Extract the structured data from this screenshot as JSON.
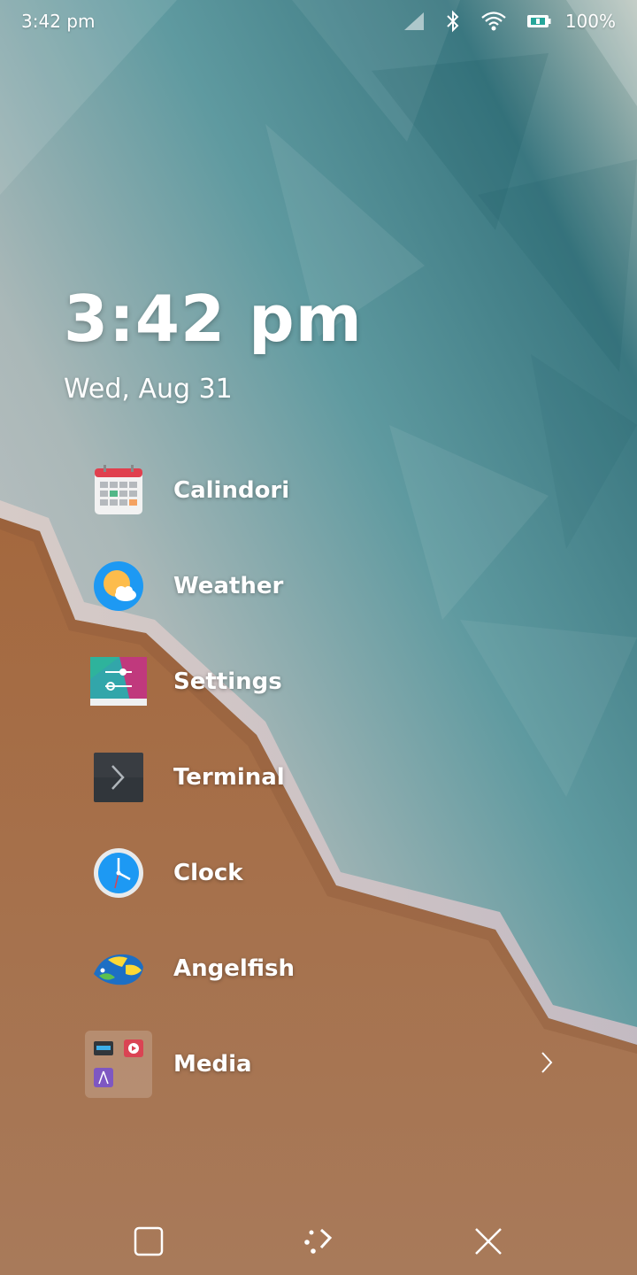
{
  "status_bar": {
    "time": "3:42 pm",
    "battery_percent": "100%",
    "icons": [
      "signal-icon",
      "bluetooth-icon",
      "wifi-icon",
      "battery-icon"
    ]
  },
  "lockscreen": {
    "clock": "3:42 pm",
    "date": "Wed, Aug 31"
  },
  "apps": [
    {
      "label": "Calindori",
      "icon": "calendar-icon"
    },
    {
      "label": "Weather",
      "icon": "weather-icon"
    },
    {
      "label": "Settings",
      "icon": "settings-icon"
    },
    {
      "label": "Terminal",
      "icon": "terminal-icon"
    },
    {
      "label": "Clock",
      "icon": "clock-icon"
    },
    {
      "label": "Angelfish",
      "icon": "angelfish-icon"
    },
    {
      "label": "Media",
      "icon": "folder-icon",
      "is_folder": true
    }
  ],
  "nav_bar": {
    "buttons": [
      "task-switcher-icon",
      "home-icon",
      "close-icon"
    ]
  },
  "colors": {
    "sky_teal": "#3f7d84",
    "sky_light": "#c9c2c6",
    "sand": "#a8693f",
    "accent_blue": "#1d99f3"
  }
}
